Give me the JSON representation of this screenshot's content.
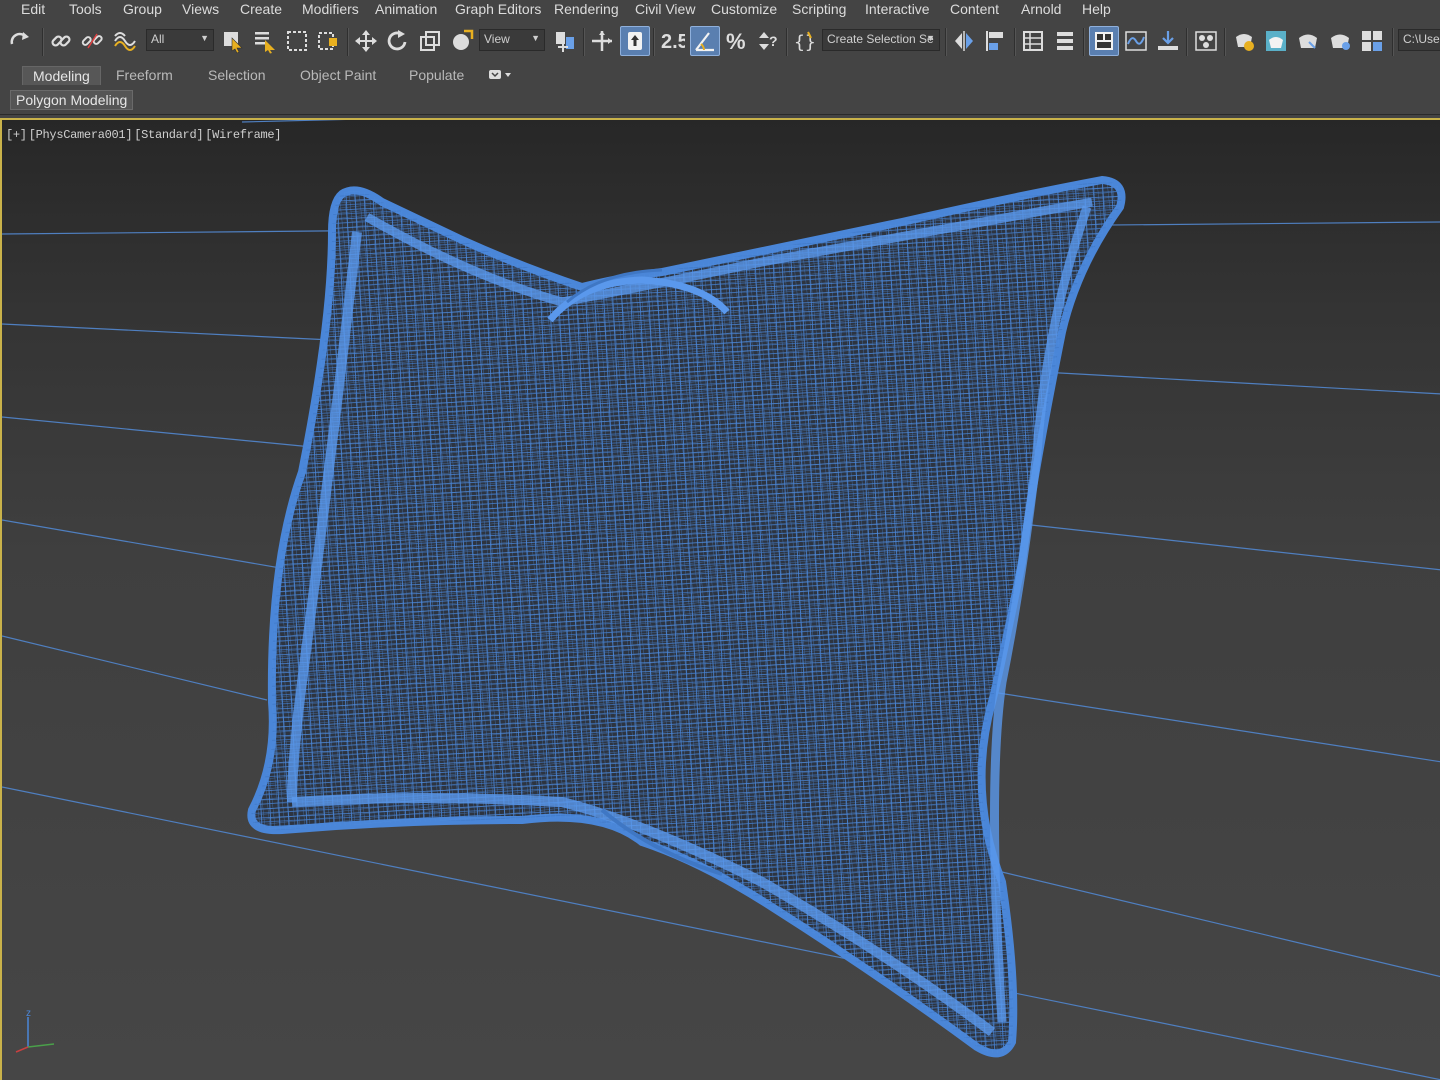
{
  "menu": [
    "Edit",
    "Tools",
    "Group",
    "Views",
    "Create",
    "Modifiers",
    "Animation",
    "Graph Editors",
    "Rendering",
    "Civil View",
    "Customize",
    "Scripting",
    "Interactive",
    "Content",
    "Arnold",
    "Help"
  ],
  "toolbar": {
    "selection_filter": "All",
    "coordinate_system": "View",
    "named_selection_placeholder": "Create Selection Se",
    "path_field": "C:\\User",
    "snap_label": "2.5",
    "icons": [
      "redo-icon",
      "link-icon",
      "unlink-icon",
      "bind-space-warp-icon",
      "select-object-icon",
      "select-by-name-icon",
      "rectangular-selection-icon",
      "window-crossing-icon",
      "select-move-icon",
      "select-rotate-icon",
      "select-scale-icon",
      "select-place-icon",
      "pivot-center-icon",
      "select-manipulate-icon",
      "keyboard-shortcut-toggle-icon",
      "snaps-toggle-icon",
      "angle-snap-icon",
      "percent-snap-icon",
      "spinner-snap-icon",
      "edit-named-selections-icon",
      "mirror-icon",
      "align-icon",
      "scene-explorer-icon",
      "layer-explorer-icon",
      "toggle-ribbon-icon",
      "curve-editor-icon",
      "schematic-view-icon",
      "material-editor-icon",
      "render-setup-icon",
      "rendered-frame-window-icon",
      "render-production-icon",
      "render-iterative-icon",
      "render-in-cloud-icon",
      "a360-gallery-icon"
    ]
  },
  "ribbon": {
    "tabs": [
      "Modeling",
      "Freeform",
      "Selection",
      "Object Paint",
      "Populate"
    ],
    "active_tab": "Modeling",
    "panel_label": "Polygon Modeling"
  },
  "viewport": {
    "label_parts": [
      "[+]",
      "[PhysCamera001]",
      "[Standard]",
      "[Wireframe]"
    ],
    "render_mode": "Wireframe",
    "object": "pillow",
    "wire_color": "#4a86d8",
    "axis_label": "z"
  }
}
